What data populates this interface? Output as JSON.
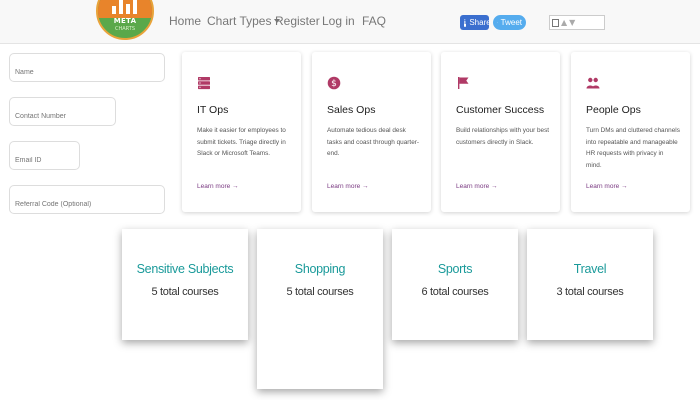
{
  "nav": {
    "logo": {
      "text": "META",
      "sub": "CHARTS"
    },
    "links": [
      "Home",
      "Chart Types",
      "Register",
      "Log in",
      "FAQ"
    ],
    "share": {
      "facebook": "Share",
      "twitter": "Tweet"
    }
  },
  "form": {
    "name_placeholder": "Name",
    "contact_placeholder": "Contact Number",
    "email_placeholder": "Email ID",
    "referral_placeholder": "Referral Code (Optional)"
  },
  "cards": [
    {
      "title": "IT Ops",
      "icon": "server-icon",
      "desc": "Make it easier for employees to submit tickets. Triage directly in Slack or Microsoft Teams.",
      "link": "Learn more →"
    },
    {
      "title": "Sales Ops",
      "icon": "dollar-icon",
      "desc": "Automate tedious deal desk tasks and coast through quarter-end.",
      "link": "Learn more →"
    },
    {
      "title": "Customer Success",
      "icon": "flag-icon",
      "desc": "Build relationships with your best customers directly in Slack.",
      "link": "Learn more →"
    },
    {
      "title": "People Ops",
      "icon": "people-icon",
      "desc": "Turn DMs and cluttered channels into repeatable and manageable HR requests with privacy in mind.",
      "link": "Learn more →"
    }
  ],
  "courses": [
    {
      "title": "Sensitive Subjects",
      "count": "5 total courses"
    },
    {
      "title": "Shopping",
      "count": "5 total courses"
    },
    {
      "title": "Sports",
      "count": "6 total courses"
    },
    {
      "title": "Travel",
      "count": "3 total courses"
    }
  ],
  "colors": {
    "accent_purple": "#7a3a82",
    "icon_pink": "#b03a66",
    "course_teal": "#1a9a9a",
    "fb_blue": "#3b6fcf",
    "tw_blue": "#55acee"
  }
}
